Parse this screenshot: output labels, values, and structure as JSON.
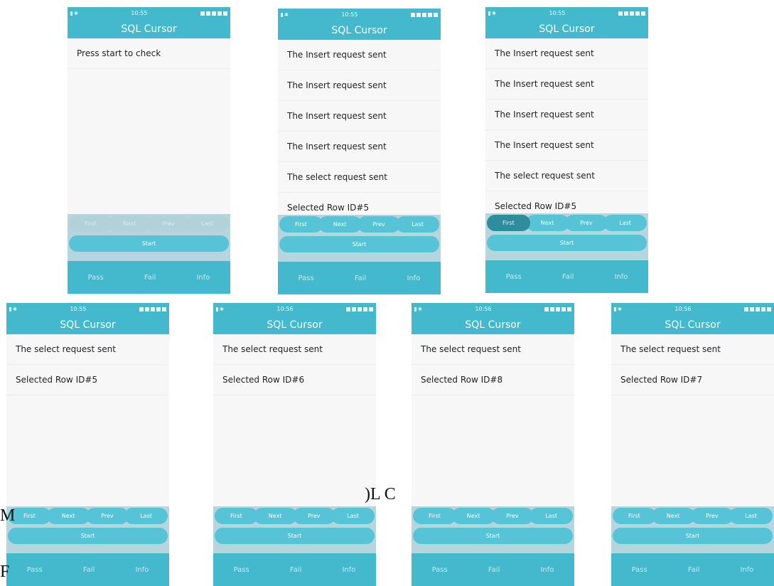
{
  "colors": {
    "accent": "#44b9cd",
    "button": "#56c3d7",
    "pressed": "#2e8c9c",
    "disabled": "#b2d1d8"
  },
  "screens": [
    {
      "status": {
        "time": "10:55"
      },
      "title": "SQL Cursor",
      "items": [
        "Press start to check"
      ],
      "nav": [
        {
          "label": "First",
          "state": "disabled"
        },
        {
          "label": "Next",
          "state": "disabled"
        },
        {
          "label": "Prev",
          "state": "disabled"
        },
        {
          "label": "Last",
          "state": "disabled"
        }
      ],
      "start": "Start",
      "footer": [
        "Pass",
        "Fail",
        "Info"
      ]
    },
    {
      "status": {
        "time": "10:55"
      },
      "title": "SQL Cursor",
      "items": [
        "The Insert request sent",
        "The Insert request sent",
        "The Insert request sent",
        "The Insert request sent",
        "The select request sent",
        "Selected Row ID#5"
      ],
      "nav": [
        {
          "label": "First",
          "state": "normal"
        },
        {
          "label": "Next",
          "state": "normal"
        },
        {
          "label": "Prev",
          "state": "normal"
        },
        {
          "label": "Last",
          "state": "normal"
        }
      ],
      "start": "Start",
      "footer": [
        "Pass",
        "Fail",
        "Info"
      ]
    },
    {
      "status": {
        "time": "10:55"
      },
      "title": "SQL Cursor",
      "items": [
        "The Insert request sent",
        "The Insert request sent",
        "The Insert request sent",
        "The Insert request sent",
        "The select request sent",
        "Selected Row ID#5"
      ],
      "nav": [
        {
          "label": "First",
          "state": "pressed"
        },
        {
          "label": "Next",
          "state": "normal"
        },
        {
          "label": "Prev",
          "state": "normal"
        },
        {
          "label": "Last",
          "state": "normal"
        }
      ],
      "start": "Start",
      "footer": [
        "Pass",
        "Fail",
        "Info"
      ]
    },
    {
      "status": {
        "time": "10:55"
      },
      "title": "SQL Cursor",
      "items": [
        "The select request sent",
        "Selected Row ID#5"
      ],
      "nav": [
        {
          "label": "First",
          "state": "normal"
        },
        {
          "label": "Next",
          "state": "normal"
        },
        {
          "label": "Prev",
          "state": "normal"
        },
        {
          "label": "Last",
          "state": "normal"
        }
      ],
      "start": "Start",
      "footer": [
        "Pass",
        "Fail",
        "Info"
      ]
    },
    {
      "status": {
        "time": "10:56"
      },
      "title": "SQL Cursor",
      "items": [
        "The select request sent",
        "Selected Row ID#6"
      ],
      "nav": [
        {
          "label": "First",
          "state": "normal"
        },
        {
          "label": "Next",
          "state": "normal"
        },
        {
          "label": "Prev",
          "state": "normal"
        },
        {
          "label": "Last",
          "state": "normal"
        }
      ],
      "start": "Start",
      "footer": [
        "Pass",
        "Fail",
        "Info"
      ]
    },
    {
      "status": {
        "time": "10:56"
      },
      "title": "SQL Cursor",
      "items": [
        "The select request sent",
        "Selected Row ID#8"
      ],
      "nav": [
        {
          "label": "First",
          "state": "normal"
        },
        {
          "label": "Next",
          "state": "normal"
        },
        {
          "label": "Prev",
          "state": "normal"
        },
        {
          "label": "Last",
          "state": "normal"
        }
      ],
      "start": "Start",
      "footer": [
        "Pass",
        "Fail",
        "Info"
      ]
    },
    {
      "status": {
        "time": "10:56"
      },
      "title": "SQL Cursor",
      "items": [
        "The select request sent",
        "Selected Row ID#7"
      ],
      "nav": [
        {
          "label": "First",
          "state": "normal"
        },
        {
          "label": "Next",
          "state": "normal"
        },
        {
          "label": "Prev",
          "state": "normal"
        },
        {
          "label": "Last",
          "state": "normal"
        }
      ],
      "start": "Start",
      "footer": [
        "Pass",
        "Fail",
        "Info"
      ]
    }
  ],
  "fragments": {
    "a": ")L C",
    "b": "M",
    "c": "F"
  }
}
